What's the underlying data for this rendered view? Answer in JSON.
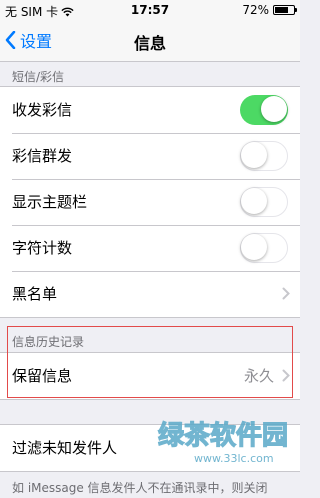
{
  "status_bar": {
    "carrier": "无 SIM 卡",
    "wifi_icon": "wifi-icon",
    "time": "17:57",
    "battery_percent": "72%",
    "battery_level": 0.72
  },
  "nav": {
    "back_label": "设置",
    "title": "信息"
  },
  "section1": {
    "header": "短信/彩信",
    "rows": [
      {
        "label": "收发彩信",
        "toggle": true
      },
      {
        "label": "彩信群发",
        "toggle": false
      },
      {
        "label": "显示主题栏",
        "toggle": false
      },
      {
        "label": "字符计数",
        "toggle": false
      },
      {
        "label": "黑名单",
        "chevron": true
      }
    ]
  },
  "section2": {
    "header": "信息历史记录",
    "row": {
      "label": "保留信息",
      "value": "永久"
    }
  },
  "section3": {
    "row": {
      "label": "过滤未知发件人"
    }
  },
  "footer": "如 iMessage 信息发件人不在通讯录中，则关闭",
  "watermark": {
    "text": "绿茶软件园",
    "url": "www.33lc.com"
  },
  "colors": {
    "accent": "#007aff",
    "toggle_on": "#4cd964",
    "highlight": "#e24a4a"
  }
}
